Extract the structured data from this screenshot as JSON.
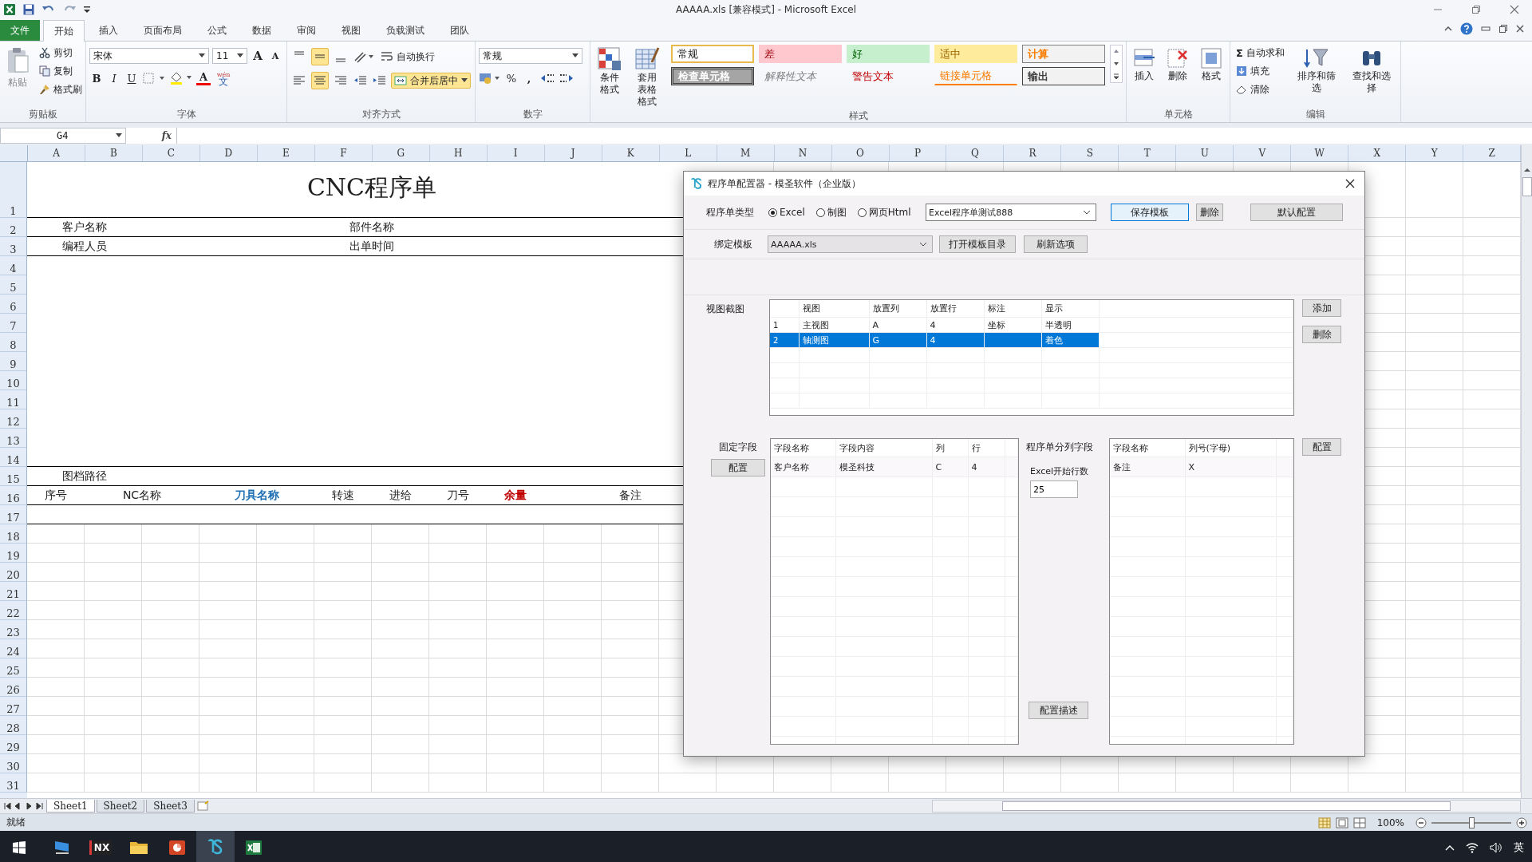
{
  "window": {
    "title": "AAAAA.xls  [兼容模式]  -  Microsoft Excel"
  },
  "ribbon_tabs": [
    {
      "label": "文件",
      "kind": "file",
      "selected": false
    },
    {
      "label": "开始",
      "kind": "tab",
      "selected": true
    },
    {
      "label": "插入",
      "kind": "tab",
      "selected": false
    },
    {
      "label": "页面布局",
      "kind": "tab",
      "selected": false
    },
    {
      "label": "公式",
      "kind": "tab",
      "selected": false
    },
    {
      "label": "数据",
      "kind": "tab",
      "selected": false
    },
    {
      "label": "审阅",
      "kind": "tab",
      "selected": false
    },
    {
      "label": "视图",
      "kind": "tab",
      "selected": false
    },
    {
      "label": "负载测试",
      "kind": "tab",
      "selected": false
    },
    {
      "label": "团队",
      "kind": "tab",
      "selected": false
    }
  ],
  "ribbon": {
    "clipboard": {
      "label": "剪贴板",
      "paste": "粘贴",
      "cut": "剪切",
      "copy": "复制",
      "painter": "格式刷"
    },
    "font": {
      "label": "字体",
      "family": "宋体",
      "size": "11",
      "grow": "A",
      "shrink": "A",
      "bold": "B",
      "italic": "I",
      "underline": "U",
      "font_color": "A",
      "phonetic": "wén",
      "phonetic_base": "文"
    },
    "alignment": {
      "label": "对齐方式",
      "vertical": [
        {
          "selected": false
        },
        {
          "selected": true
        },
        {
          "selected": false
        }
      ],
      "horizontal": [
        {
          "selected": false
        },
        {
          "selected": true
        },
        {
          "selected": false
        }
      ],
      "wrap": "自动换行",
      "merge": {
        "label": "合并后居中",
        "selected": true
      }
    },
    "number": {
      "label": "数字",
      "format": "常规",
      "percent": "%",
      "comma": ","
    },
    "styles": {
      "label": "样式",
      "conditional": "条件格式",
      "table": [
        "套用",
        "表格格式"
      ],
      "gallery": [
        {
          "label": "常规",
          "kind": "normal"
        },
        {
          "label": "差",
          "kind": "bad"
        },
        {
          "label": "好",
          "kind": "good"
        },
        {
          "label": "适中",
          "kind": "neutral"
        },
        {
          "label": "计算",
          "kind": "calculation"
        },
        {
          "label": "检查单元格",
          "kind": "check"
        },
        {
          "label": "解释性文本",
          "kind": "explanatory"
        },
        {
          "label": "警告文本",
          "kind": "warning"
        },
        {
          "label": "链接单元格",
          "kind": "linked"
        },
        {
          "label": "输出",
          "kind": "output"
        }
      ]
    },
    "cells": {
      "label": "单元格",
      "insert": "插入",
      "delete": "删除",
      "format": "格式"
    },
    "editing": {
      "label": "编辑",
      "autosum_symbol": "Σ",
      "autosum": "自动求和",
      "fill": "填充",
      "clear": "清除",
      "sort": "排序和筛选",
      "find": "查找和选择"
    }
  },
  "formula_bar": {
    "name_box": "G4",
    "function_label": "fx"
  },
  "sheet": {
    "columns": [
      "A",
      "B",
      "C",
      "D",
      "E",
      "F",
      "G",
      "H",
      "I",
      "J",
      "K",
      "L",
      "M",
      "N",
      "O",
      "P",
      "Q",
      "R",
      "S",
      "T",
      "U",
      "V",
      "W",
      "X",
      "Y",
      "Z"
    ],
    "rows": [
      "1",
      "2",
      "3",
      "4",
      "5",
      "6",
      "7",
      "8",
      "9",
      "10",
      "11",
      "12",
      "13",
      "14",
      "15",
      "16",
      "17",
      "18",
      "19",
      "20",
      "21",
      "22",
      "23",
      "24",
      "25",
      "26",
      "27",
      "28",
      "29",
      "30",
      "31"
    ],
    "title": "CNC程序单",
    "info_labels": [
      "客户名称",
      "部件名称",
      "编程人员",
      "出单时间"
    ],
    "path_label": "图档路径",
    "headers": [
      {
        "label": "序号",
        "kind": "plain"
      },
      {
        "label": "NC名称",
        "kind": "plain"
      },
      {
        "label": "刀具名称",
        "kind": "blue"
      },
      {
        "label": "转速",
        "kind": "plain"
      },
      {
        "label": "进给",
        "kind": "plain"
      },
      {
        "label": "刀号",
        "kind": "plain"
      },
      {
        "label": "余量",
        "kind": "red"
      },
      {
        "label": "备注",
        "kind": "plain"
      }
    ]
  },
  "sheet_tabs": [
    {
      "label": "Sheet1",
      "selected": true
    },
    {
      "label": "Sheet2",
      "selected": false
    },
    {
      "label": "Sheet3",
      "selected": false
    }
  ],
  "status_bar": {
    "text": "就绪",
    "zoom": "100%",
    "zoom_slider": {
      "level": 0.5
    }
  },
  "taskbar": {
    "apps": [
      {
        "kind": "monitor",
        "selected": false
      },
      {
        "kind": "nx",
        "label": "NX",
        "selected": false
      },
      {
        "kind": "folder",
        "selected": false
      },
      {
        "kind": "slides",
        "selected": false
      },
      {
        "kind": "configurator",
        "selected": true
      },
      {
        "kind": "excel",
        "selected": false
      }
    ],
    "ime": "英"
  },
  "dialog": {
    "title": "程序单配置器 - 模圣软件（企业版）",
    "type_label": "程序单类型",
    "types": [
      {
        "label": "Excel",
        "selected": true
      },
      {
        "label": "制图",
        "selected": false
      },
      {
        "label": "网页Html",
        "selected": false
      }
    ],
    "config_select": "Excel程序单测试888",
    "save_button": "保存模板",
    "delete_button": "删除",
    "default_button": "默认配置",
    "template_label": "绑定模板",
    "template_select": "AAAAA.xls",
    "open_dir_button": "打开模板目录",
    "refresh_button": "刷新选项",
    "views_label": "视图截图",
    "views": {
      "columns": [
        "视图",
        "放置列",
        "放置行",
        "标注",
        "显示"
      ],
      "rows": [
        {
          "number": "1",
          "view": "主视图",
          "column": "A",
          "row": "4",
          "note": "坐标",
          "display": "半透明",
          "selected": false
        },
        {
          "number": "2",
          "view": "轴测图",
          "column": "G",
          "row": "4",
          "display": "着色",
          "selected": true
        }
      ]
    },
    "add_button": "添加",
    "remove_button": "删除",
    "fixed_label": "固定字段",
    "fixed_config_button": "配置",
    "fixed_fields": {
      "columns": [
        "字段名称",
        "字段内容",
        "列",
        "行"
      ],
      "rows": [
        {
          "name": "客户名称",
          "content": "模圣科技",
          "column": "C",
          "row": "4"
        }
      ]
    },
    "split_label": "程序单分列字段",
    "start_row_label": "Excel开始行数",
    "start_row": "25",
    "describe_button": "配置描述",
    "split_fields": {
      "columns": [
        "字段名称",
        "列号(字母)"
      ],
      "rows": [
        {
          "name": "备注",
          "column": "X"
        }
      ]
    },
    "split_config_button": "配置"
  }
}
